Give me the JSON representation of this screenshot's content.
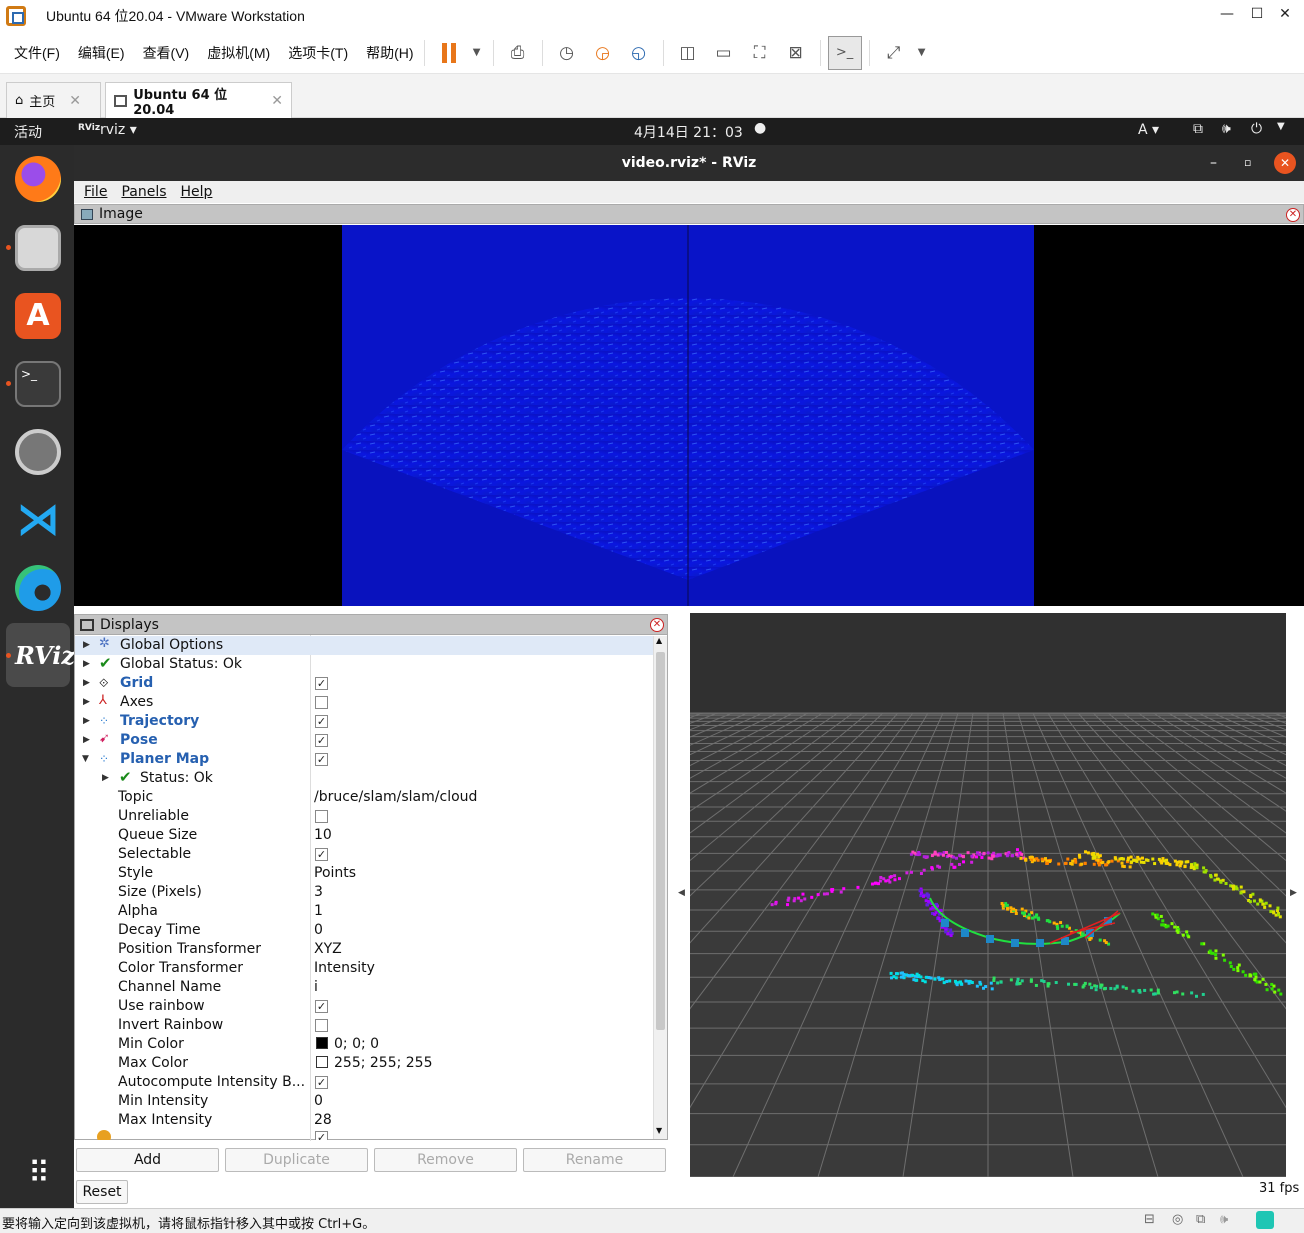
{
  "window": {
    "title": "Ubuntu 64 位20.04 - VMware Workstation"
  },
  "menu": [
    "文件(F)",
    "编辑(E)",
    "查看(V)",
    "虚拟机(M)",
    "选项卡(T)",
    "帮助(H)"
  ],
  "tabs": [
    {
      "label": "主页"
    },
    {
      "label": "Ubuntu 64 位20.04"
    }
  ],
  "ubuntu_bar": {
    "activities": "活动",
    "app": "rviz",
    "clock": "4月14日  21：03",
    "input": "A"
  },
  "rviz": {
    "title": "video.rviz* - RViz",
    "menu": [
      "File",
      "Panels",
      "Help"
    ],
    "image_panel": "Image",
    "displays_panel": "Displays",
    "buttons": {
      "add": "Add",
      "duplicate": "Duplicate",
      "remove": "Remove",
      "rename": "Rename",
      "reset": "Reset"
    },
    "fps": "31 fps"
  },
  "displays": {
    "global_options": "Global Options",
    "global_status": "Global Status: Ok",
    "items": [
      {
        "label": "Grid",
        "checked": true
      },
      {
        "label": "Axes",
        "checked": false
      },
      {
        "label": "Trajectory",
        "checked": true
      },
      {
        "label": "Pose",
        "checked": true
      },
      {
        "label": "Planer Map",
        "checked": true
      }
    ],
    "status_ok": "Status: Ok",
    "properties": [
      {
        "name": "Topic",
        "value": "/bruce/slam/slam/cloud"
      },
      {
        "name": "Unreliable",
        "check": false
      },
      {
        "name": "Queue Size",
        "value": "10"
      },
      {
        "name": "Selectable",
        "check": true
      },
      {
        "name": "Style",
        "value": "Points"
      },
      {
        "name": "Size (Pixels)",
        "value": "3"
      },
      {
        "name": "Alpha",
        "value": "1"
      },
      {
        "name": "Decay Time",
        "value": "0"
      },
      {
        "name": "Position Transformer",
        "value": "XYZ"
      },
      {
        "name": "Color Transformer",
        "value": "Intensity"
      },
      {
        "name": "Channel Name",
        "value": "i"
      },
      {
        "name": "Use rainbow",
        "check": true
      },
      {
        "name": "Invert Rainbow",
        "check": false
      },
      {
        "name": "Min Color",
        "value": "0; 0; 0",
        "swatch": "#000000"
      },
      {
        "name": "Max Color",
        "value": "255; 255; 255",
        "swatch": "#ffffff"
      },
      {
        "name": "Autocompute Intensity B...",
        "check": true
      },
      {
        "name": "Min Intensity",
        "value": "0"
      },
      {
        "name": "Max Intensity",
        "value": "28"
      }
    ]
  },
  "statusbar": {
    "message": "要将输入定向到该虚拟机，请将鼠标指针移入其中或按 Ctrl+G。"
  },
  "colors": {
    "sonar": "#0a14d8",
    "grid_bg": "#303030",
    "dock": "#2b2b2b",
    "rviz_accent": "#2660b0"
  },
  "icons": [
    "home-icon",
    "vm-tab-icon",
    "pause-icon",
    "snapshot-icon",
    "fullscreen-icon",
    "firefox-icon",
    "files-icon",
    "software-icon",
    "terminal-icon",
    "settings-icon",
    "vscode-icon",
    "edge-icon",
    "rviz-icon",
    "apps-grid-icon"
  ]
}
